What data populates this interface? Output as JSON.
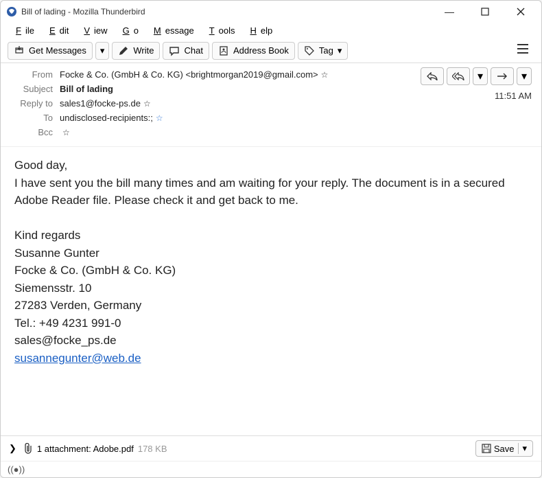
{
  "window": {
    "title": "Bill of lading - Mozilla Thunderbird"
  },
  "menu": {
    "file": "File",
    "edit": "Edit",
    "view": "View",
    "go": "Go",
    "message": "Message",
    "tools": "Tools",
    "help": "Help"
  },
  "toolbar": {
    "get_messages": "Get Messages",
    "write": "Write",
    "chat": "Chat",
    "address_book": "Address Book",
    "tag": "Tag"
  },
  "headers": {
    "from_label": "From",
    "from_value": "Focke & Co. (GmbH & Co. KG) <brightmorgan2019@gmail.com>",
    "subject_label": "Subject",
    "subject_value": "Bill of lading",
    "reply_to_label": "Reply to",
    "reply_to_value": "sales1@focke-ps.de",
    "to_label": "To",
    "to_value": "undisclosed-recipients:;",
    "bcc_label": "Bcc",
    "bcc_value": "                ",
    "time": "11:51 AM"
  },
  "body": {
    "greeting": "Good day,",
    "para1": "I have sent you the bill many times and am waiting for your reply. The document is in a secured Adobe Reader file. Please check it and get back to me.",
    "signoff": "Kind regards",
    "name": "Susanne Gunter",
    "company": "Focke & Co. (GmbH & Co. KG)",
    "address1": "Siemensstr. 10",
    "address2": "27283 Verden, Germany",
    "tel": "Tel.: +49 4231 991-0",
    "email1": "sales@focke_ps.de",
    "email2": "susannegunter@web.de"
  },
  "attachment": {
    "count_text": "1 attachment: Adobe.pdf",
    "size": "178 KB",
    "save": "Save"
  },
  "status": {
    "icon_label": "((●))"
  }
}
